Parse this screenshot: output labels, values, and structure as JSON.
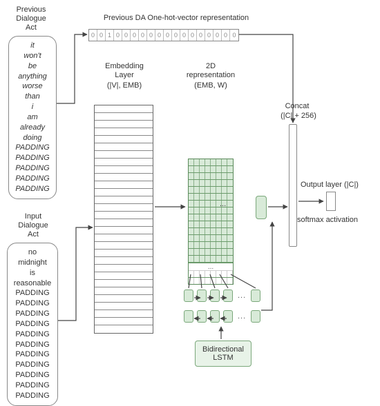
{
  "labels": {
    "prev_da_title": "Previous\nDialogue\nAct",
    "onehot_title": "Previous DA One-hot-vector representation",
    "input_da_title": "Input\nDialogue\nAct",
    "embedding_title": "Embedding\nLayer",
    "embedding_sub": "(|V|, EMB)",
    "repr2d_title": "2D\nrepresentation",
    "repr2d_sub": "(EMB, W)",
    "concat_title": "Concat",
    "concat_sub": "(|C| + 256)",
    "output_title": "Output layer  (|C|)",
    "softmax": "softmax activation",
    "bilstm": "Bidirectional\nLSTM",
    "grid_dots": "...",
    "lstm_dots": "..."
  },
  "previous_dialogue_tokens": [
    {
      "text": "it",
      "style": "italic"
    },
    {
      "text": "won't",
      "style": "italic"
    },
    {
      "text": "be",
      "style": "italic"
    },
    {
      "text": "anything",
      "style": "italic"
    },
    {
      "text": "worse",
      "style": "italic"
    },
    {
      "text": "than",
      "style": "italic"
    },
    {
      "text": "i",
      "style": "italic"
    },
    {
      "text": "am",
      "style": "italic"
    },
    {
      "text": "already",
      "style": "italic"
    },
    {
      "text": "doing",
      "style": "italic"
    },
    {
      "text": "PADDING",
      "style": "italic"
    },
    {
      "text": "PADDING",
      "style": "italic"
    },
    {
      "text": "PADDING",
      "style": "italic"
    },
    {
      "text": "PADDING",
      "style": "italic"
    },
    {
      "text": "PADDING",
      "style": "italic"
    }
  ],
  "input_dialogue_tokens": [
    {
      "text": "no",
      "style": "normal"
    },
    {
      "text": "midnight",
      "style": "normal"
    },
    {
      "text": "is",
      "style": "normal"
    },
    {
      "text": "reasonable",
      "style": "normal"
    },
    {
      "text": "PADDING",
      "style": "normal"
    },
    {
      "text": "PADDING",
      "style": "normal"
    },
    {
      "text": "PADDING",
      "style": "normal"
    },
    {
      "text": "PADDING",
      "style": "normal"
    },
    {
      "text": "PADDING",
      "style": "normal"
    },
    {
      "text": "PADDING",
      "style": "normal"
    },
    {
      "text": "PADDING",
      "style": "normal"
    },
    {
      "text": "PADDING",
      "style": "normal"
    },
    {
      "text": "PADDING",
      "style": "normal"
    },
    {
      "text": "PADDING",
      "style": "normal"
    },
    {
      "text": "PADDING",
      "style": "normal"
    }
  ],
  "onehot_vector": [
    0,
    0,
    1,
    0,
    0,
    0,
    0,
    0,
    0,
    0,
    0,
    0,
    0,
    0,
    0,
    0,
    0,
    0
  ],
  "embedding_rows": 30,
  "grid2d": {
    "rows_green": 15,
    "cols": 8,
    "rows_white": 2
  },
  "bilstm_layers": 2,
  "bilstm_cells_visible": 5,
  "concat_height": 256,
  "output_classes": "|C|",
  "colors": {
    "green_fill": "#d8ead8",
    "green_stroke": "#7aa77a",
    "box_stroke": "#888",
    "text": "#333"
  }
}
